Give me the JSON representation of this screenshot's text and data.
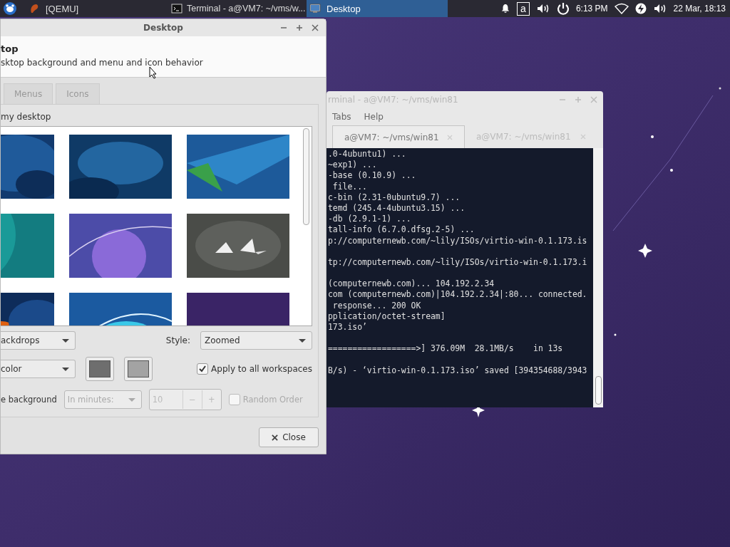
{
  "taskbar": {
    "tasks": [
      {
        "label": "[QEMU]",
        "selected": false
      },
      {
        "label": "Terminal - a@VM7: ~/vms/w...",
        "selected": false
      },
      {
        "label": "Desktop",
        "selected": true
      }
    ],
    "keyboard_layout": "a",
    "clock": "6:13 PM",
    "date_time": "22 Mar, 18:13"
  },
  "terminal": {
    "title": "rminal - a@VM7: ~/vms/win81",
    "menus": [
      "Tabs",
      "Help"
    ],
    "tabs": [
      {
        "label": "a@VM7: ~/vms/win81",
        "selected": true
      },
      {
        "label": "a@VM7: ~/vms/win81",
        "selected": false
      }
    ],
    "lines": [
      {
        "text": ".0-4ubuntu1) ...",
        "blank_after": false
      },
      {
        "text": "~exp1) ...",
        "blank_after": false
      },
      {
        "text": "-base (0.10.9) ...",
        "blank_after": false
      },
      {
        "text": " file...",
        "blank_after": false
      },
      {
        "text": "c-bin (2.31-0ubuntu9.7) ...",
        "blank_after": false
      },
      {
        "text": "temd (245.4-4ubuntu3.15) ...",
        "blank_after": false
      },
      {
        "text": "-db (2.9.1-1) ...",
        "blank_after": false
      },
      {
        "text": "tall-info (6.7.0.dfsg.2-5) ...",
        "blank_after": false
      },
      {
        "text": "p://computernewb.com/~lily/ISOs/virtio-win-0.1.173.is",
        "blank_after": true
      },
      {
        "text": "tp://computernewb.com/~lily/ISOs/virtio-win-0.1.173.i",
        "blank_after": true
      },
      {
        "text": "(computernewb.com)... 104.192.2.34",
        "blank_after": false
      },
      {
        "text": "com (computernewb.com)|104.192.2.34|:80... connected.",
        "blank_after": false
      },
      {
        "text": " response... 200 OK",
        "blank_after": false
      },
      {
        "text": "pplication/octet-stream]",
        "blank_after": false
      },
      {
        "text": "173.iso’",
        "blank_after": true
      },
      {
        "text": "==================>] 376.09M  28.1MB/s    in 13s",
        "blank_after": true
      },
      {
        "text": "B/s) - ‘virtio-win-0.1.173.iso’ saved [394354688/3943",
        "blank_after": false
      }
    ]
  },
  "dialog": {
    "title": "Desktop",
    "heading": "top",
    "subtitle": "sktop background and menu and icon behavior",
    "tabs": [
      {
        "label": "Menus",
        "selected": false
      },
      {
        "label": "Icons",
        "selected": false
      }
    ],
    "folder_label": "my desktop",
    "folder_select": "ackdrops",
    "style_label": "Style:",
    "style_select": "Zoomed",
    "color_select": "color",
    "colors": [
      {
        "color": "#6e6e6e"
      },
      {
        "color": "#a3a3a3"
      }
    ],
    "apply_all": {
      "label": "Apply to all workspaces",
      "checked": true
    },
    "change_label": "e background",
    "interval_select": {
      "value": "In minutes:",
      "disabled": true
    },
    "interval": {
      "value": "10",
      "decrement": "−",
      "increment": "+",
      "disabled": true
    },
    "random_order": {
      "label": "Random Order",
      "checked": false,
      "disabled": true
    },
    "close_button": "Close"
  }
}
